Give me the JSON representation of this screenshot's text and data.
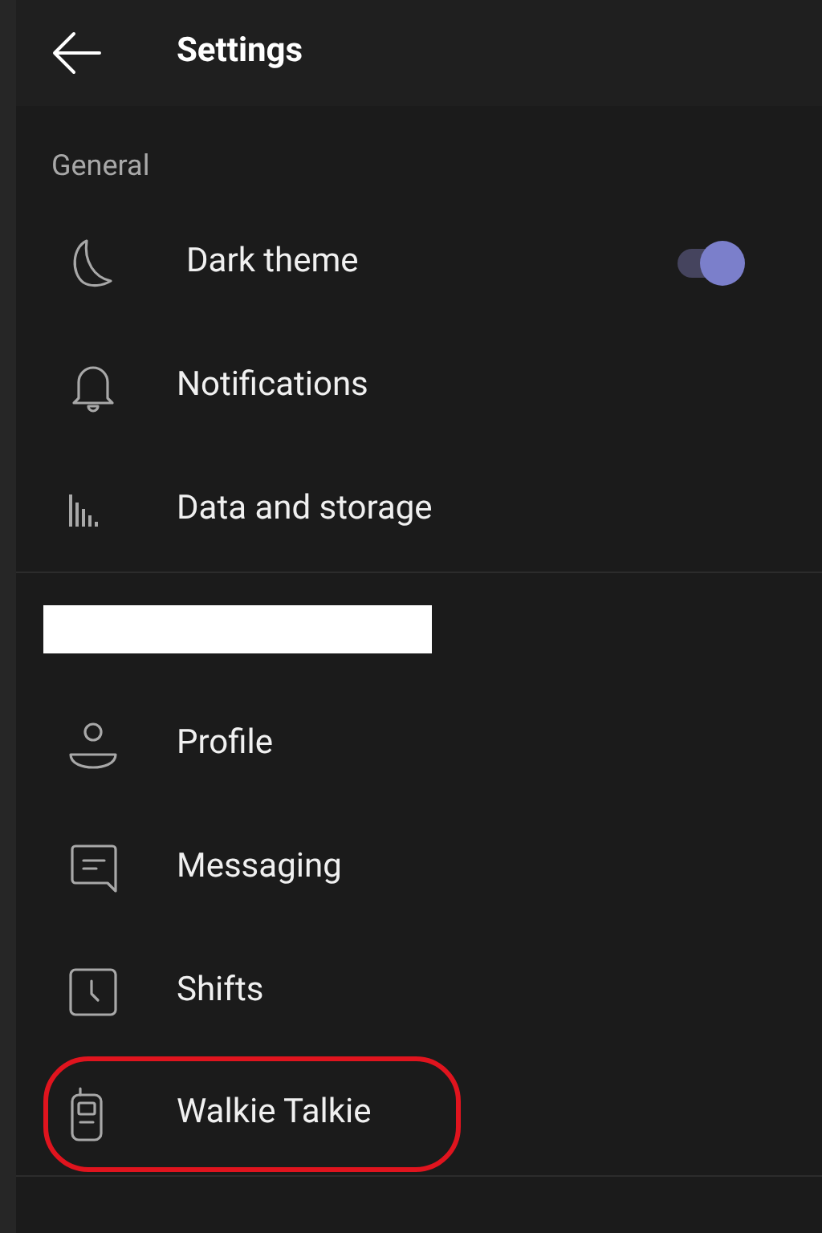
{
  "header": {
    "title": "Settings"
  },
  "sections": [
    {
      "title": "General",
      "items": [
        {
          "label": "Dark theme",
          "kind": "toggle",
          "on": true,
          "highlighted": false
        },
        {
          "label": "Notifications",
          "kind": "link",
          "highlighted": false
        },
        {
          "label": "Data and storage",
          "kind": "link",
          "highlighted": false
        }
      ]
    },
    {
      "redacted": true,
      "items": [
        {
          "label": "Profile",
          "kind": "link",
          "highlighted": false
        },
        {
          "label": "Messaging",
          "kind": "link",
          "highlighted": false
        },
        {
          "label": "Shifts",
          "kind": "link",
          "highlighted": false
        },
        {
          "label": "Walkie Talkie",
          "kind": "link",
          "highlighted": true
        }
      ]
    }
  ]
}
